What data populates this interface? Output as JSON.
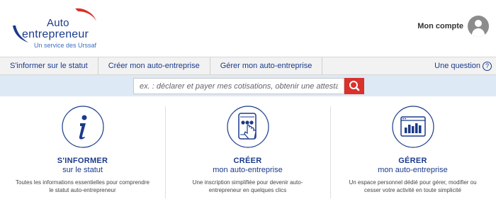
{
  "header": {
    "logo": {
      "line1": "Auto",
      "line2": "entrepreneur",
      "line3": "Un service des Urssaf"
    },
    "account_label": "Mon compte"
  },
  "nav": {
    "items": [
      {
        "label": "S'informer sur le statut"
      },
      {
        "label": "Créer mon auto-entreprise"
      },
      {
        "label": "Gérer mon auto-entreprise"
      }
    ],
    "question_label": "Une question",
    "question_icon": "?"
  },
  "search": {
    "placeholder": "ex. : déclarer et payer mes cotisations, obtenir une attestation..."
  },
  "columns": [
    {
      "icon": "info-icon",
      "title": "S'INFORMER",
      "subtitle": "sur le statut",
      "description": "Toutes les informations essentielles pour comprendre le statut auto-entrepreneur"
    },
    {
      "icon": "tablet-touch-icon",
      "title": "CRÉER",
      "subtitle": "mon auto-entreprise",
      "description": "Une inscription simplifiée pour devenir auto-entrepreneur en quelques clics"
    },
    {
      "icon": "dashboard-chart-icon",
      "title": "GÉRER",
      "subtitle": "mon auto-entreprise",
      "description": "Un espace personnel dédié pour gérer, modifier ou cesser votre activité en toute simplicité"
    }
  ],
  "colors": {
    "brand_blue": "#1a3a8a",
    "accent_red": "#d9312b",
    "search_band": "#dde9f5",
    "nav_bg": "#f2f2f2"
  }
}
